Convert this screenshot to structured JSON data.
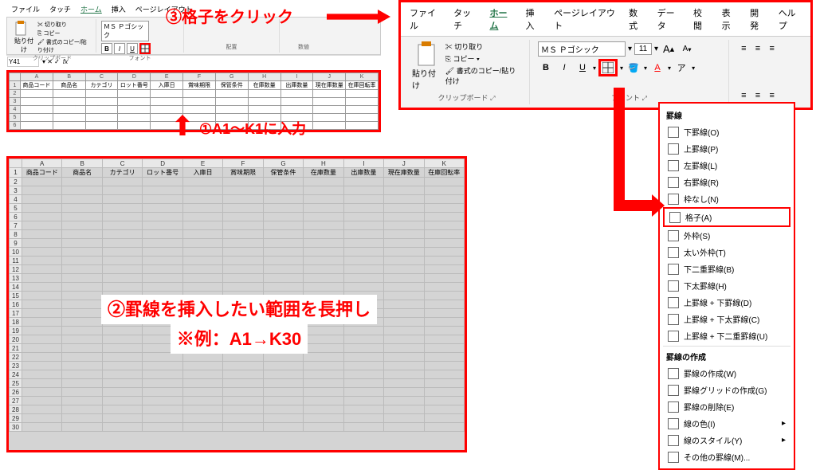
{
  "small_ribbon": {
    "tabs": [
      "ファイル",
      "タッチ",
      "ホーム",
      "挿入",
      "ページレイアウト"
    ],
    "active_tab": 2,
    "clipboard": {
      "paste": "貼り付け",
      "cut": "切り取り",
      "copy": "コピー",
      "format": "書式のコピー/貼り付け",
      "label": "クリップボード"
    },
    "font": {
      "name": "ＭＳ Ｐゴシック",
      "bold": "B",
      "italic": "I",
      "underline": "U",
      "label": "フォント"
    },
    "alignment_label": "配置",
    "number_label": "数値"
  },
  "formula": {
    "cell": "Y41",
    "fx": "fx"
  },
  "columns": [
    "A",
    "B",
    "C",
    "D",
    "E",
    "F",
    "G",
    "H",
    "I",
    "J",
    "K"
  ],
  "headers": [
    "商品コード",
    "商品名",
    "カテゴリ",
    "ロット番号",
    "入庫日",
    "賞味期限",
    "保管条件",
    "在庫数量",
    "出庫数量",
    "現在庫数量",
    "在庫回転率"
  ],
  "mini_rows": 6,
  "big_ribbon": {
    "tabs": [
      "ファイル",
      "タッチ",
      "ホーム",
      "挿入",
      "ページレイアウト",
      "数式",
      "データ",
      "校閲",
      "表示",
      "開発",
      "ヘルプ"
    ],
    "active_tab": 2,
    "clipboard": {
      "paste": "貼り付け",
      "cut": "切り取り",
      "copy": "コピー",
      "format": "書式のコピー/貼り付け",
      "label": "クリップボード"
    },
    "font": {
      "name": "ＭＳ Ｐゴシック",
      "size": "11",
      "increase": "A",
      "decrease": "A",
      "bold": "B",
      "italic": "I",
      "underline": "U",
      "label": "フォント"
    }
  },
  "borders_menu": {
    "title": "罫線",
    "items": [
      {
        "label": "下罫線(O)"
      },
      {
        "label": "上罫線(P)"
      },
      {
        "label": "左罫線(L)"
      },
      {
        "label": "右罫線(R)"
      },
      {
        "label": "枠なし(N)"
      },
      {
        "label": "格子(A)",
        "hl": true
      },
      {
        "label": "外枠(S)"
      },
      {
        "label": "太い外枠(T)"
      },
      {
        "label": "下二重罫線(B)"
      },
      {
        "label": "下太罫線(H)"
      },
      {
        "label": "上罫線 + 下罫線(D)"
      },
      {
        "label": "上罫線 + 下太罫線(C)"
      },
      {
        "label": "上罫線 + 下二重罫線(U)"
      }
    ],
    "create_title": "罫線の作成",
    "create_items": [
      {
        "label": "罫線の作成(W)"
      },
      {
        "label": "罫線グリッドの作成(G)"
      },
      {
        "label": "罫線の削除(E)"
      },
      {
        "label": "線の色(I)",
        "arrow": true
      },
      {
        "label": "線のスタイル(Y)",
        "arrow": true
      },
      {
        "label": "その他の罫線(M)..."
      }
    ]
  },
  "big_sheet_rows": 30,
  "annotations": {
    "a1": "③格子をクリック",
    "a2": "①A1～K1に入力",
    "a3_line1": "②罫線を挿入したい範囲を長押し",
    "a3_line2": "※例：A1→K30"
  }
}
